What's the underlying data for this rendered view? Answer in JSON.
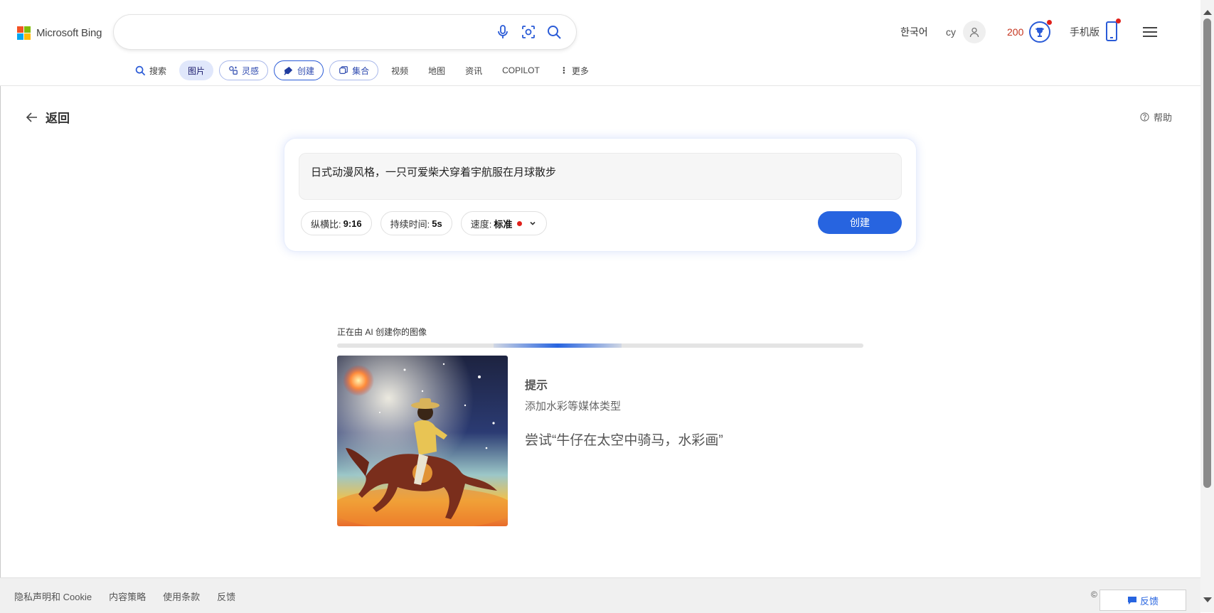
{
  "brand": {
    "logo_text": "Microsoft Bing"
  },
  "search": {
    "value": "",
    "placeholder": ""
  },
  "header": {
    "language": "한국어",
    "user_name": "cy",
    "points": "200",
    "mobile_label": "手机版"
  },
  "nav": {
    "tabs": [
      {
        "label": "搜索"
      },
      {
        "label": "图片"
      },
      {
        "label": "灵感"
      },
      {
        "label": "创建"
      },
      {
        "label": "集合"
      },
      {
        "label": "视频"
      },
      {
        "label": "地图"
      },
      {
        "label": "资讯"
      },
      {
        "label": "COPILOT"
      },
      {
        "label": "更多"
      }
    ]
  },
  "page": {
    "back_label": "返回",
    "help_label": "帮助"
  },
  "creator": {
    "prompt_text": "日式动漫风格，一只可爱柴犬穿着宇航服在月球散步",
    "aspect_label": "纵横比:",
    "aspect_value": "9:16",
    "duration_label": "持续时间:",
    "duration_value": "5s",
    "speed_label": "速度:",
    "speed_value": "标准",
    "create_label": "创建"
  },
  "progress": {
    "label": "正在由 AI 创建你的图像"
  },
  "tip": {
    "title": "提示",
    "subtitle": "添加水彩等媒体类型",
    "example": "尝试“牛仔在太空中骑马，水彩画”"
  },
  "footer": {
    "links": [
      "隐私声明和 Cookie",
      "内容策略",
      "使用条款",
      "反馈"
    ],
    "copyright": "©",
    "feedback_button": "反馈"
  },
  "colors": {
    "accent": "#2764e0",
    "points": "#c5341e",
    "notification": "#e0201b"
  }
}
